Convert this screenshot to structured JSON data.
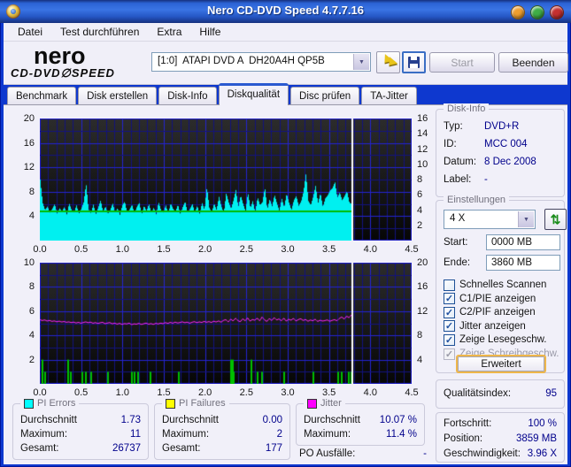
{
  "window": {
    "title": "Nero CD-DVD Speed 4.7.7.16"
  },
  "menu": {
    "items": [
      "Datei",
      "Test durchführen",
      "Extra",
      "Hilfe"
    ]
  },
  "toolbar": {
    "logo_top": "nero",
    "logo_sub": "CD-DVD∅SPEED",
    "drive": "[1:0]  ATAPI DVD A  DH20A4H QP5B",
    "start_label": "Start",
    "quit_label": "Beenden"
  },
  "tabs": {
    "items": [
      "Benchmark",
      "Disk erstellen",
      "Disk-Info",
      "Diskqualität",
      "Disc prüfen",
      "TA-Jitter"
    ],
    "selected": "Diskqualität"
  },
  "disk_info": {
    "title": "Disk-Info",
    "rows": [
      {
        "label": "Typ:",
        "value": "DVD+R"
      },
      {
        "label": "ID:",
        "value": "MCC 004"
      },
      {
        "label": "Datum:",
        "value": "8 Dec 2008"
      },
      {
        "label": "Label:",
        "value": "-"
      }
    ]
  },
  "settings": {
    "title": "Einstellungen",
    "speed": "4 X",
    "start_label": "Start:",
    "start_value": "0000 MB",
    "end_label": "Ende:",
    "end_value": "3860 MB",
    "checkboxes": [
      {
        "label": "Schnelles Scannen",
        "checked": false,
        "disabled": false
      },
      {
        "label": "C1/PIE anzeigen",
        "checked": true,
        "disabled": false
      },
      {
        "label": "C2/PIF anzeigen",
        "checked": true,
        "disabled": false
      },
      {
        "label": "Jitter anzeigen",
        "checked": true,
        "disabled": false
      },
      {
        "label": "Zeige Lesegeschw.",
        "checked": true,
        "disabled": false
      },
      {
        "label": "Zeige Schreibgeschw.",
        "checked": true,
        "disabled": true
      }
    ],
    "advanced_label": "Erweitert"
  },
  "quality": {
    "label": "Qualitätsindex:",
    "value": "95"
  },
  "progress": {
    "rows": [
      {
        "label": "Fortschritt:",
        "value": "100 %"
      },
      {
        "label": "Position:",
        "value": "3859 MB"
      },
      {
        "label": "Geschwindigkeit:",
        "value": "3.96 X"
      }
    ]
  },
  "stats": {
    "pi_errors": {
      "title": "PI Errors",
      "swatch": "#00ffff",
      "rows": [
        {
          "label": "Durchschnitt",
          "value": "1.73"
        },
        {
          "label": "Maximum:",
          "value": "11"
        },
        {
          "label": "Gesamt:",
          "value": "26737"
        }
      ]
    },
    "pi_failures": {
      "title": "PI Failures",
      "swatch": "#ffff00",
      "rows": [
        {
          "label": "Durchschnitt",
          "value": "0.00"
        },
        {
          "label": "Maximum:",
          "value": "2"
        },
        {
          "label": "Gesamt:",
          "value": "177"
        }
      ]
    },
    "jitter": {
      "title": "Jitter",
      "swatch": "#ff00ff",
      "rows": [
        {
          "label": "Durchschnitt",
          "value": "10.07 %"
        },
        {
          "label": "Maximum:",
          "value": "11.4 %"
        }
      ]
    },
    "po_label": "PO Ausfälle:",
    "po_value": "-"
  },
  "chart_data": [
    {
      "type": "area",
      "name": "pi-errors-scan",
      "canvas": "pi-errors-chart-canvas",
      "x_unit": "GB",
      "xlim": [
        0,
        4.5
      ],
      "x_ticks": [
        "0.0",
        "0.5",
        "1.0",
        "1.5",
        "2.0",
        "2.5",
        "3.0",
        "3.5",
        "4.0",
        "4.5"
      ],
      "left_axis": {
        "lim": [
          0,
          20
        ],
        "ticks": [
          20,
          16,
          12,
          8,
          4
        ]
      },
      "right_axis": {
        "lim": [
          0,
          16
        ],
        "ticks": [
          16,
          14,
          12,
          10,
          8,
          6,
          4,
          2
        ]
      },
      "grid": {
        "h_step": 2,
        "h_bright_every": 4,
        "v_minor": 0.1,
        "v_major": 0.5
      },
      "data_end_x": 3.77,
      "cursor_x": 3.77,
      "series": [
        {
          "name": "PI Errors",
          "style": "bars",
          "axis": "left",
          "color": "#00f0f0",
          "values": [
            10.0,
            6.2,
            5.0,
            5.6,
            4.6,
            5.2,
            6.0,
            4.4,
            5.3,
            4.8,
            5.5,
            4.3,
            6.1,
            5.0,
            4.6,
            5.8,
            4.4,
            5.2,
            6.3,
            9.3,
            5.1,
            4.5,
            5.9,
            4.3,
            5.4,
            6.6,
            4.7,
            5.6,
            4.4,
            5.0,
            6.1,
            4.6,
            5.3,
            4.2,
            5.8,
            6.4,
            4.5,
            5.1,
            5.9,
            4.4,
            5.5,
            6.2,
            4.3,
            5.7,
            4.8,
            6.0,
            4.5,
            5.4,
            4.3,
            6.3,
            5.0,
            4.6,
            5.8,
            4.4,
            6.1,
            5.2,
            4.7,
            5.9,
            4.3,
            5.5,
            6.4,
            4.5,
            5.2,
            6.0,
            4.6,
            5.7,
            4.4,
            6.2,
            5.0,
            8.8,
            5.4,
            4.6,
            6.1,
            5.0,
            7.2,
            5.6,
            4.5,
            7.8,
            6.3,
            5.2,
            6.6,
            8.3,
            5.5,
            7.4,
            6.0,
            4.8,
            7.9,
            5.3,
            6.5,
            4.6,
            7.1,
            5.8,
            6.3,
            8.7,
            5.1,
            6.8,
            5.6,
            7.5,
            6.1,
            4.9,
            6.9,
            5.4,
            7.7,
            6.2,
            5.0,
            6.6,
            7.3,
            5.7,
            6.4,
            8.0,
            11.0,
            6.5,
            5.8,
            7.2,
            9.0,
            6.1,
            7.8,
            5.5,
            6.9,
            7.4,
            8.2,
            8.6,
            9.6,
            7.0,
            7.9,
            6.6,
            7.3,
            8.1,
            6.2,
            6.0
          ]
        },
        {
          "name": "Lesegeschwindigkeit",
          "style": "hline",
          "axis": "right",
          "color": "#00bb00",
          "constant": 4
        }
      ]
    },
    {
      "type": "line",
      "name": "pif-and-jitter-scan",
      "canvas": "pif-jitter-chart-canvas",
      "x_unit": "GB",
      "xlim": [
        0,
        4.5
      ],
      "x_ticks": [
        "0.0",
        "0.5",
        "1.0",
        "1.5",
        "2.0",
        "2.5",
        "3.0",
        "3.5",
        "4.0",
        "4.5"
      ],
      "left_axis": {
        "lim": [
          0,
          10
        ],
        "ticks": [
          10,
          8,
          6,
          4,
          2
        ]
      },
      "right_axis": {
        "lim": [
          0,
          20
        ],
        "ticks": [
          20,
          16,
          12,
          8,
          4
        ]
      },
      "grid": {
        "h_step": 1,
        "h_bright_every": 2,
        "v_minor": 0.1,
        "v_major": 0.5
      },
      "data_end_x": 3.77,
      "cursor_x": 3.77,
      "series": [
        {
          "name": "PI Failures",
          "style": "bars_sparse",
          "axis": "left",
          "color": "#00c000",
          "points": [
            {
              "x": 0.02,
              "v": 2
            },
            {
              "x": 0.05,
              "v": 1
            },
            {
              "x": 0.33,
              "v": 2
            },
            {
              "x": 0.36,
              "v": 1
            },
            {
              "x": 0.5,
              "v": 1
            },
            {
              "x": 0.55,
              "v": 1
            },
            {
              "x": 0.61,
              "v": 1
            },
            {
              "x": 0.81,
              "v": 1
            },
            {
              "x": 1.1,
              "v": 1
            },
            {
              "x": 1.14,
              "v": 1
            },
            {
              "x": 1.18,
              "v": 1
            },
            {
              "x": 1.33,
              "v": 1
            },
            {
              "x": 1.67,
              "v": 1
            },
            {
              "x": 2.3,
              "v": 2
            },
            {
              "x": 2.32,
              "v": 2
            },
            {
              "x": 2.34,
              "v": 1
            },
            {
              "x": 2.55,
              "v": 2
            },
            {
              "x": 2.63,
              "v": 1
            },
            {
              "x": 2.68,
              "v": 1
            },
            {
              "x": 2.95,
              "v": 1
            },
            {
              "x": 3.3,
              "v": 1
            },
            {
              "x": 3.6,
              "v": 1
            },
            {
              "x": 3.64,
              "v": 1
            },
            {
              "x": 3.73,
              "v": 1
            },
            {
              "x": 3.76,
              "v": 1
            }
          ]
        },
        {
          "name": "Jitter %",
          "style": "line",
          "axis": "right",
          "color": "#ff22ff",
          "values": [
            10.6,
            10.44,
            10.56,
            10.36,
            10.48,
            10.3,
            10.4,
            10.24,
            10.36,
            10.2,
            10.3,
            10.16,
            10.24,
            10.1,
            10.2,
            10.04,
            10.16,
            10.0,
            10.12,
            10.24,
            10.08,
            10.2,
            10.0,
            10.12,
            9.96,
            10.08,
            10.16,
            9.92,
            10.04,
            10.12,
            9.9,
            10.04,
            9.84,
            10.0,
            9.8,
            9.96,
            9.88,
            10.04,
            9.76,
            9.92,
            9.84,
            10.0,
            9.8,
            9.92,
            10.04,
            9.84,
            9.96,
            9.8,
            10.0,
            9.88,
            10.04,
            9.92,
            10.12,
            9.96,
            10.16,
            10.0,
            10.2,
            10.04,
            10.12,
            10.24,
            10.08,
            10.2,
            10.0,
            10.16,
            10.28,
            10.08,
            10.24,
            10.12,
            10.32,
            10.16,
            10.28,
            10.12,
            10.36,
            10.2,
            10.4,
            10.16,
            10.48,
            10.6,
            10.2,
            10.72,
            10.36,
            10.84,
            10.44,
            10.24,
            10.76,
            10.4,
            10.92,
            10.32,
            10.64,
            10.48,
            10.88,
            10.36,
            11.04,
            10.56,
            10.28,
            10.8,
            10.44,
            10.96,
            10.52,
            10.72,
            10.4,
            10.88,
            10.32,
            10.68,
            10.48,
            10.84,
            10.36,
            10.6,
            10.76,
            10.44,
            10.64,
            10.32,
            10.56,
            10.4,
            10.68,
            10.28,
            10.52,
            10.36,
            10.44,
            10.56,
            10.32,
            10.48,
            10.6,
            10.4,
            10.8,
            11.04,
            10.68,
            11.2,
            10.9,
            11.4
          ]
        }
      ]
    }
  ]
}
